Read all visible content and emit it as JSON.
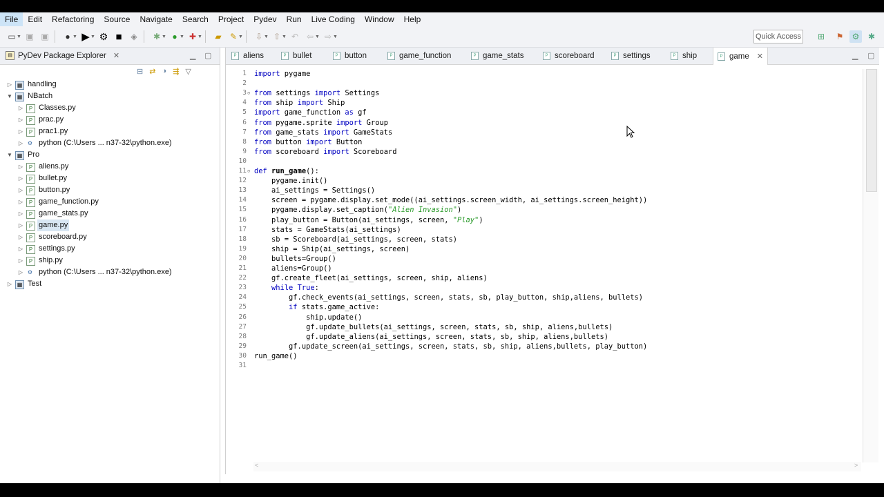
{
  "menu": [
    "File",
    "Edit",
    "Refactoring",
    "Source",
    "Navigate",
    "Search",
    "Project",
    "Pydev",
    "Run",
    "Live Coding",
    "Window",
    "Help"
  ],
  "toolbar": {
    "quick_access": "Quick Access"
  },
  "explorer": {
    "title": "PyDev Package Explorer",
    "tree": [
      {
        "label": "handling",
        "type": "project",
        "expanded": false,
        "level": 0
      },
      {
        "label": "NBatch",
        "type": "project",
        "expanded": true,
        "level": 0
      },
      {
        "label": "Classes.py",
        "type": "file",
        "level": 1
      },
      {
        "label": "prac.py",
        "type": "file",
        "level": 1
      },
      {
        "label": "prac1.py",
        "type": "file",
        "level": 1
      },
      {
        "label": "python  (C:\\Users ... n37-32\\python.exe)",
        "type": "interpreter",
        "level": 1
      },
      {
        "label": "Pro",
        "type": "project",
        "expanded": true,
        "level": 0
      },
      {
        "label": "aliens.py",
        "type": "file",
        "level": 1
      },
      {
        "label": "bullet.py",
        "type": "file",
        "level": 1
      },
      {
        "label": "button.py",
        "type": "file",
        "level": 1
      },
      {
        "label": "game_function.py",
        "type": "file",
        "level": 1
      },
      {
        "label": "game_stats.py",
        "type": "file",
        "level": 1
      },
      {
        "label": "game.py",
        "type": "file",
        "level": 1,
        "selected": true
      },
      {
        "label": "scoreboard.py",
        "type": "file",
        "level": 1
      },
      {
        "label": "settings.py",
        "type": "file",
        "level": 1
      },
      {
        "label": "ship.py",
        "type": "file",
        "level": 1
      },
      {
        "label": "python  (C:\\Users ... n37-32\\python.exe)",
        "type": "interpreter",
        "level": 1
      },
      {
        "label": "Test",
        "type": "project",
        "expanded": false,
        "level": 0
      }
    ]
  },
  "editor": {
    "tabs": [
      "aliens",
      "bullet",
      "button",
      "game_function",
      "game_stats",
      "scoreboard",
      "settings",
      "ship",
      "game"
    ],
    "active_tab": "game",
    "lines": [
      "import pygame",
      "",
      "from settings import Settings",
      "from ship import Ship",
      "import game_function as gf",
      "from pygame.sprite import Group",
      "from game_stats import GameStats",
      "from button import Button",
      "from scoreboard import Scoreboard",
      "",
      "def run_game():",
      "    pygame.init()",
      "    ai_settings = Settings()",
      "    screen = pygame.display.set_mode((ai_settings.screen_width, ai_settings.screen_height))",
      "    pygame.display.set_caption(\"Alien Invasion\")",
      "    play_button = Button(ai_settings, screen, \"Play\")",
      "    stats = GameStats(ai_settings)",
      "    sb = Scoreboard(ai_settings, screen, stats)",
      "    ship = Ship(ai_settings, screen)",
      "    bullets=Group()",
      "    aliens=Group()",
      "    gf.create_fleet(ai_settings, screen, ship, aliens)",
      "    while True:",
      "        gf.check_events(ai_settings, screen, stats, sb, play_button, ship,aliens, bullets)",
      "        if stats.game_active:",
      "            ship.update()",
      "            gf.update_bullets(ai_settings, screen, stats, sb, ship, aliens,bullets)",
      "            gf.update_aliens(ai_settings, screen, stats, sb, ship, aliens,bullets)",
      "        gf.update_screen(ai_settings, screen, stats, sb, ship, aliens,bullets, play_button)",
      "run_game()",
      ""
    ]
  }
}
